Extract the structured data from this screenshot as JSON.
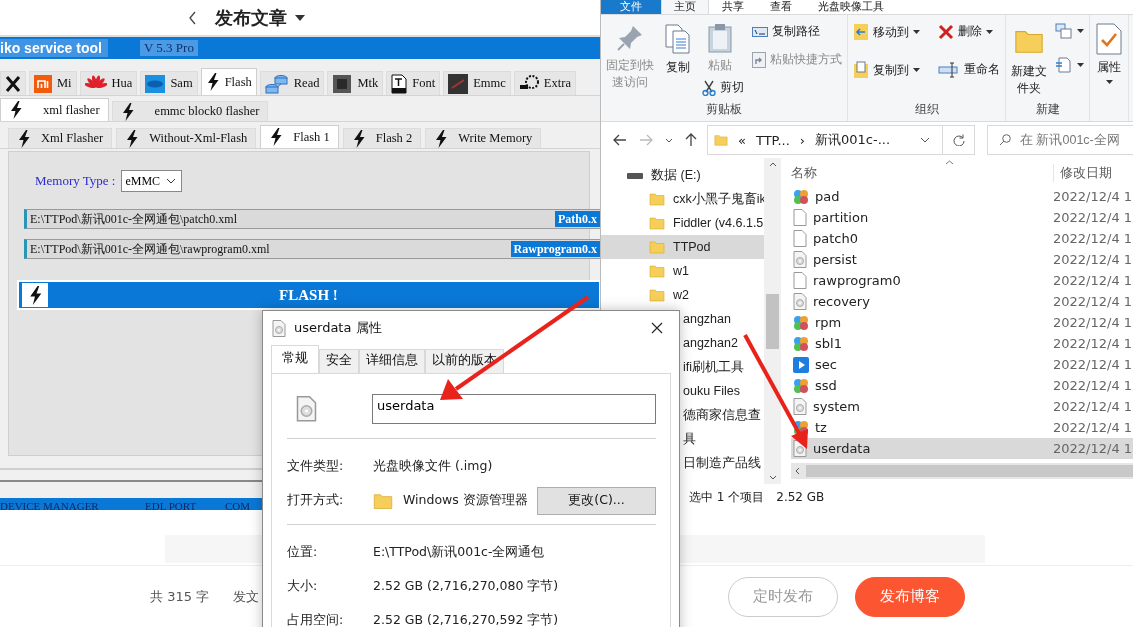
{
  "blog": {
    "title": "发布文章",
    "word_count": "共 315 字",
    "settings_link": "发文",
    "buttons": [
      {
        "label": "定时发布",
        "kind": "outline"
      },
      {
        "label": "发布博客",
        "kind": "primary"
      }
    ]
  },
  "tool_window": {
    "title": "iko service tool",
    "version": "V 5.3 Pro",
    "brand_tabs": [
      {
        "kind": "tools",
        "selected": false
      },
      {
        "kind": "mi",
        "label": "Mi",
        "selected": false
      },
      {
        "kind": "huawei",
        "label": "Hua",
        "selected": false
      },
      {
        "kind": "samsung",
        "label": "Sam",
        "selected": false
      },
      {
        "kind": "flash",
        "label": "Flash",
        "selected": true
      },
      {
        "kind": "read",
        "label": "Read",
        "selected": false
      },
      {
        "kind": "chip",
        "label": "Mtk",
        "selected": false
      },
      {
        "kind": "font",
        "label": "Font",
        "selected": false
      },
      {
        "kind": "emmc",
        "label": "Emmc",
        "selected": false
      },
      {
        "kind": "extra",
        "label": "Extra",
        "selected": false
      }
    ],
    "flasher_tabs": [
      {
        "label": "xml flasher",
        "selected": true
      },
      {
        "label": "emmc block0 flasher",
        "selected": false
      }
    ],
    "flash_tabs": [
      {
        "label": "Xml Flasher",
        "selected": false
      },
      {
        "label": "Without-Xml-Flash",
        "selected": false
      },
      {
        "label": "Flash 1",
        "selected": true
      },
      {
        "label": "Flash 2",
        "selected": false
      },
      {
        "label": "Write Memory",
        "selected": false
      }
    ],
    "memory_type": {
      "label": "Memory Type :",
      "value": "eMMC"
    },
    "paths": [
      {
        "value": "E:\\TTPod\\新讯001c-全网通包\\patch0.xml",
        "button": "Path0.x"
      },
      {
        "value": "E:\\TTPod\\新讯001c-全网通包\\rawprogram0.xml",
        "button": "Rawprogram0.x"
      }
    ],
    "flash_button": "FLASH !",
    "status_bar": [
      "DEVICE MANAGER",
      "EDL PORT",
      "COM"
    ]
  },
  "explorer": {
    "ribbon_tabs": [
      {
        "label": "文件",
        "kind": "file",
        "selected": false
      },
      {
        "label": "主页",
        "kind": "tab",
        "selected": true
      },
      {
        "label": "共享",
        "kind": "tab",
        "selected": false
      },
      {
        "label": "查看",
        "kind": "tab",
        "selected": false
      },
      {
        "label": "光盘映像工具",
        "kind": "tab",
        "selected": false
      }
    ],
    "ribbon_groups": [
      {
        "label": "剪贴板",
        "commands": [
          {
            "label": "固定到快速访问",
            "kind": "large",
            "disabled": true
          },
          {
            "label": "复制",
            "kind": "large",
            "disabled": false
          },
          {
            "label": "粘贴",
            "kind": "medium",
            "disabled": true
          },
          {
            "label": "剪切",
            "kind": "small",
            "disabled": false
          },
          {
            "label": "复制路径",
            "kind": "small",
            "disabled": false
          },
          {
            "label": "粘贴快捷方式",
            "kind": "small",
            "disabled": true
          }
        ]
      },
      {
        "label": "组织",
        "commands": [
          {
            "label": "移动到",
            "kind": "small",
            "has_menu": true,
            "disabled": false
          },
          {
            "label": "复制到",
            "kind": "small",
            "has_menu": true,
            "disabled": false
          },
          {
            "label": "删除",
            "kind": "small",
            "has_menu": true,
            "disabled": false
          },
          {
            "label": "重命名",
            "kind": "small",
            "disabled": false
          }
        ]
      },
      {
        "label": "新建",
        "commands": [
          {
            "label": "新建文件夹",
            "kind": "large",
            "disabled": false
          },
          {
            "kind": "icon",
            "has_menu": true,
            "disabled": false
          },
          {
            "kind": "icon",
            "has_menu": true,
            "disabled": false
          }
        ]
      },
      {
        "commands": [
          {
            "label": "属性",
            "kind": "large",
            "has_menu": true,
            "disabled": false
          }
        ]
      }
    ],
    "address": [
      "«",
      "TTP...",
      "›",
      "新讯001c-..."
    ],
    "search_placeholder": "在 新讯001c-全网",
    "nav": [
      {
        "label": "数据 (E:)",
        "kind": "drive",
        "selected": false
      },
      {
        "label": "cxk小黑子鬼畜ik",
        "kind": "folder",
        "selected": false
      },
      {
        "label": "Fiddler (v4.6.1.5",
        "kind": "folder",
        "selected": false
      },
      {
        "label": "TTPod",
        "kind": "folder",
        "selected": true
      },
      {
        "label": "w1",
        "kind": "folder",
        "selected": false
      },
      {
        "label": "w2",
        "kind": "folder",
        "selected": false
      },
      {
        "label": "angzhan",
        "kind": "partial",
        "selected": false
      },
      {
        "label": "angzhan2",
        "kind": "partial",
        "selected": false
      },
      {
        "label": "ifi刷机工具",
        "kind": "partial",
        "selected": false
      },
      {
        "label": "ouku Files",
        "kind": "partial",
        "selected": false
      },
      {
        "label": "德商家信息查",
        "kind": "partial",
        "selected": false
      },
      {
        "label": "具",
        "kind": "partial",
        "selected": false
      },
      {
        "label": "日制造产品线",
        "kind": "partial",
        "selected": false
      }
    ],
    "columns": [
      "名称",
      "修改日期"
    ],
    "files": [
      {
        "name": "pad",
        "kind": "multi",
        "date": "2022/12/4 1",
        "selected": false
      },
      {
        "name": "partition",
        "kind": "blank",
        "date": "2022/12/4 1",
        "selected": false
      },
      {
        "name": "patch0",
        "kind": "blank",
        "date": "2022/12/4 1",
        "selected": false
      },
      {
        "name": "persist",
        "kind": "disc",
        "date": "2022/12/4 1",
        "selected": false
      },
      {
        "name": "rawprogram0",
        "kind": "blank",
        "date": "2022/12/4 1",
        "selected": false
      },
      {
        "name": "recovery",
        "kind": "disc",
        "date": "2022/12/4 1",
        "selected": false
      },
      {
        "name": "rpm",
        "kind": "multi",
        "date": "2022/12/4 1",
        "selected": false
      },
      {
        "name": "sbl1",
        "kind": "multi",
        "date": "2022/12/4 1",
        "selected": false
      },
      {
        "name": "sec",
        "kind": "play",
        "date": "2022/12/4 1",
        "selected": false
      },
      {
        "name": "ssd",
        "kind": "multi",
        "date": "2022/12/4 1",
        "selected": false
      },
      {
        "name": "system",
        "kind": "disc",
        "date": "2022/12/4 1",
        "selected": false
      },
      {
        "name": "tz",
        "kind": "multi",
        "date": "2022/12/4 1",
        "selected": false
      },
      {
        "name": "userdata",
        "kind": "disc",
        "date": "2022/12/4 1",
        "selected": true
      }
    ],
    "status": [
      "选中 1 个项目",
      "2.52 GB"
    ]
  },
  "dialog": {
    "title": "userdata 属性",
    "tabs": [
      {
        "label": "常规",
        "selected": true
      },
      {
        "label": "安全",
        "selected": false
      },
      {
        "label": "详细信息",
        "selected": false
      },
      {
        "label": "以前的版本",
        "selected": false
      }
    ],
    "name": "userdata",
    "sections": [
      [
        {
          "label": "文件类型:",
          "value": "光盘映像文件 (.img)",
          "kind": "text"
        },
        {
          "label": "打开方式:",
          "value": "Windows 资源管理器",
          "button": "更改(C)...",
          "kind": "app"
        }
      ],
      [
        {
          "label": "位置:",
          "value": "E:\\TTPod\\新讯001c-全网通包",
          "kind": "text"
        },
        {
          "label": "大小:",
          "value": "2.52 GB (2,716,270,080 字节)",
          "kind": "text"
        },
        {
          "label": "占用空间:",
          "value": "2.52 GB (2,716,270,592 字节)",
          "kind": "text"
        }
      ]
    ]
  }
}
